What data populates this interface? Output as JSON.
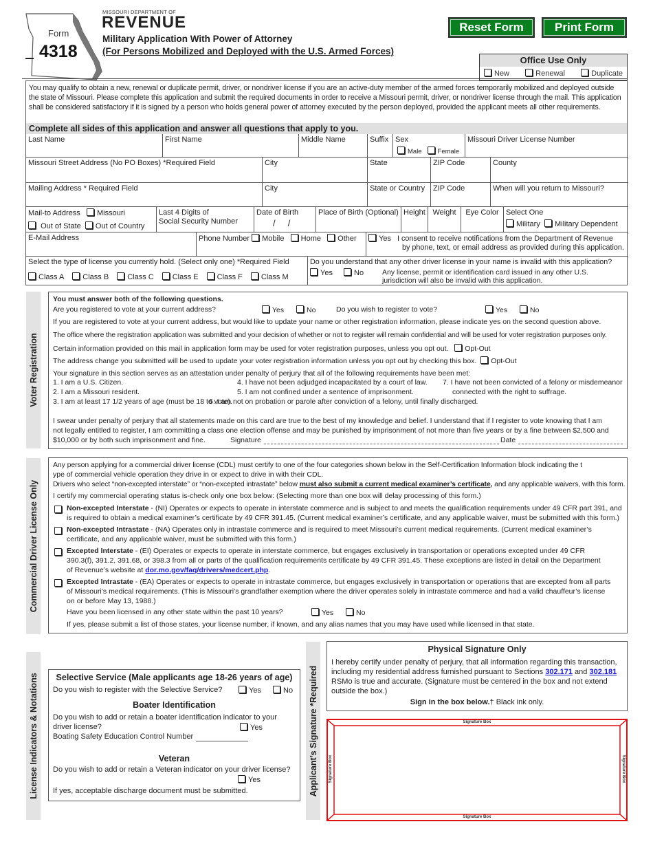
{
  "header": {
    "department_small": "MISSOURI DEPARTMENT OF",
    "department_large": "REVENUE",
    "form_label": "Form",
    "form_number": "4318",
    "title_line1": "Military Application With Power of Attorney",
    "title_line2": "(For Persons Mobilized and Deployed with the U.S. Armed Forces)",
    "reset_button": "Reset Form",
    "print_button": "Print Form",
    "button_color": "#0a7f1f"
  },
  "office_use": {
    "title": "Office Use Only",
    "options": [
      "New",
      "Renewal",
      "Duplicate"
    ]
  },
  "intro": "You may qualify to obtain a new, renewal or duplicate permit, driver, or nondriver license if you are an active-duty member of the armed forces temporarily mobilized and deployed outside the state of Missouri.  Please complete this application and submit the required documents in order to receive a Missouri permit, driver, or nondriver license through the mail. This application shall be considered satisfactory if it is signed by a person who holds general power of attorney executed by the person deployed, provided the applicant meets all other requirements.",
  "complete_banner": "Complete all sides of this application and answer all questions that apply to you.",
  "fields": {
    "last_name": "Last Name",
    "first_name": "First Name",
    "middle_name": "Middle Name",
    "suffix": "Suffix",
    "sex": "Sex",
    "male": "Male",
    "female": "Female",
    "dl_number": "Missouri Driver License Number",
    "street": "Missouri Street Address (No PO Boxes) *Required Field",
    "city": "City",
    "state": "State",
    "zip": "ZIP Code",
    "county": "County",
    "mailing": "Mailing Address * Required Field",
    "state_or_country": "State or Country",
    "return": "When will you return to Missouri?",
    "mail_to": "Mail-to Address",
    "mail_missouri": "Missouri",
    "mail_out_state": "Out of State",
    "mail_out_country": "Out of Country",
    "ssn_line1": "Last 4 Digits of",
    "ssn_line2": "Social Security Number",
    "dob": "Date of Birth",
    "dob_sep": "/",
    "pob": "Place of Birth (Optional)",
    "height": "Height",
    "weight": "Weight",
    "eye": "Eye Color",
    "select_one": "Select One",
    "military": "Military",
    "military_dependent": "Military Dependent",
    "email": "E-Mail Address",
    "phone": "Phone Number",
    "mobile": "Mobile",
    "home": "Home",
    "other": "Other",
    "consent_yes": "Yes",
    "consent_line1": "I consent to receive notifications from the Department of Revenue",
    "consent_line2": "by phone, text, or email address as provided during this application.",
    "license_type": "Select the type of license you currently hold. (Select only one) *Required Field",
    "classes": [
      "Class A",
      "Class B",
      "Class C",
      "Class E",
      "Class F",
      "Class M"
    ],
    "invalid_q": "Do you understand that any other driver license in your name is invalid with this application?",
    "yes": "Yes",
    "no": "No",
    "invalid_note1": "Any license, permit or identification card issued in any other U.S.",
    "invalid_note2": "jurisdiction will also be invalid with this application."
  },
  "voter": {
    "tab": "Voter Registration",
    "heading": "You must answer both of the following questions.",
    "q1": "Are you registered to vote at your current address?",
    "q2": "Do you wish to register to vote?",
    "yes": "Yes",
    "no": "No",
    "p1": "If you are registered to vote at your current address, but would like to update your name or other registration information, please indicate yes on the second question above.",
    "p2": "The office where the registration application was submitted and your decision of whether or not to register will  remain confidential and will be used for voter registration purposes only.",
    "p3": "Certain information provided on this mail in application form may be used for voter registration purposes, unless you opt out.",
    "p4": "The address change you submitted will be used to update your voter registration information unless you opt out by checking this box.",
    "opt_out": "Opt-Out",
    "attest": "Your signature in this section serves as an attestation under penalty of perjury that all of the following requirements have been met:",
    "req": [
      "1. I am a U.S. Citizen.",
      "2. I am a Missouri resident.",
      "3. I am at least 17 1/2 years of age (must be 18 to vote).",
      "4. I have not been adjudged incapacitated by a court of law.",
      "5. I am not confined under a sentence of imprisonment.",
      "6. I am not on probation or parole after conviction of a felony, until finally discharged.",
      "7. I have not been convicted of a felony or misdemeanor",
      "connected with the right to suffrage."
    ],
    "swear1": "I swear under penalty of perjury that all statements made on this card are true to the best of my knowledge and belief. I understand that if I register to vote knowing that I am",
    "swear2": "not legally entitled to register, I am committing a class one election offense and may be punished by imprisonment of not more than five years or by a fine between $2,500 and",
    "swear3": "$10,000 or by both such imprisonment and fine.",
    "signature": "Signature",
    "date": "Date"
  },
  "cdl": {
    "tab": "Commercial Driver License Only",
    "p1a": "Any person applying for a commercial driver license (CDL) must certify to one of the four categories shown below in the Self-Certification Information block indicating the t",
    "p1b": "ype of commercial vehicle operation they drive in or expect to drive in with their CDL.",
    "p2a": "Drivers who select “non-excepted interstate” or “non-excepted intrastate” below",
    "p2b": "must also submit a current medical examiner’s certificate,",
    "p2c": " and any applicable waivers, with this form.",
    "p3": "I certify my commercial operating status is-check only one box below:  (Selecting more than one box will delay processing of this form.)",
    "options": [
      {
        "title": "Non-excepted Interstate",
        "l1": " - (NI) Operates or expects to operate in interstate commerce and is subject to and meets the qualification requirements under 49 CFR part 391, and",
        "l2": "is required to obtain a medical examiner’s certificate by 49 CFR 391.45.  (Current medical examiner’s certificate, and any applicable waiver, must be submitted with this form.)",
        "l3": ""
      },
      {
        "title": "Non-excepted Intrastate",
        "l1": " - (NA) Operates only in intrastate commerce and is required to meet Missouri’s current medical requirements.  (Current medical examiner’s",
        "l2": "certificate, and any applicable waiver, must be submitted with this form.)",
        "l3": ""
      },
      {
        "title": "Excepted Interstate",
        "l1": " - (EI) Operates or expects to operate in interstate commerce, but engages exclusively in transportation or operations excepted under 49 CFR",
        "l2": "390.3(f), 391.2, 391.68, or 398.3 from all or parts of the qualification requirements certificate by 49 CFR 391.45.  These exceptions are listed in detail on the Department",
        "l3": "of Revenue’s website at "
      },
      {
        "title": "Excepted Intrastate",
        "l1": " - (EA) Operates or expects to operate in intrastate commerce, but engages exclusively in transportation or operations that are excepted from all parts",
        "l2": "of Missouri’s medical requirements. (This is Missouri’s grandfather exemption where the driver operates solely in intrastate commerce and had a valid chauffeur’s license",
        "l3": "on or before May 13, 1988.)"
      }
    ],
    "link": "dor.mo.gov/faq/drivers/medcert.php",
    "q_other_state": "Have you been licensed in any other state within the past 10 years?",
    "yes": "Yes",
    "no": "No",
    "if_yes": "If yes, please submit a list of those states, your license number, if known, and any alias names that you may have used while licensed in that state."
  },
  "indicators": {
    "tab": "License Indicators & Notations",
    "ss_title": "Selective Service (Male applicants age 18-26 years of age)",
    "ss_q": "Do you wish to register with the Selective Service?",
    "yes": "Yes",
    "no": "No",
    "boater_title": "Boater Identification",
    "boater_q1": "Do you wish to add or retain a boater identification indicator to your",
    "boater_q2": "driver license?",
    "boater_control": "Boating Safety Education Control Number",
    "veteran_title": "Veteran",
    "veteran_q": "Do you wish to add or retain a Veteran indicator on your driver license?",
    "veteran_note": "If yes, acceptable discharge document must be submitted."
  },
  "signature": {
    "tab": "Applicant’s Signature *Required",
    "title": "Physical Signature Only",
    "l1": "I hereby certify under penalty of perjury, that all information regarding this transaction,",
    "l2a": "including my residential address furnished pursuant to Sections ",
    "link1": "302.171",
    "and": " and ",
    "link2": "302.181",
    "l3": "RSMo is true and accurate. (Signature must be centered in the box and not extend",
    "l4": "outside the box.)",
    "sign_bold": "Sign in the box below.",
    "sign_rest": "† Black ink only.",
    "box_label": "Signature Box",
    "box_color": "#e01010"
  }
}
